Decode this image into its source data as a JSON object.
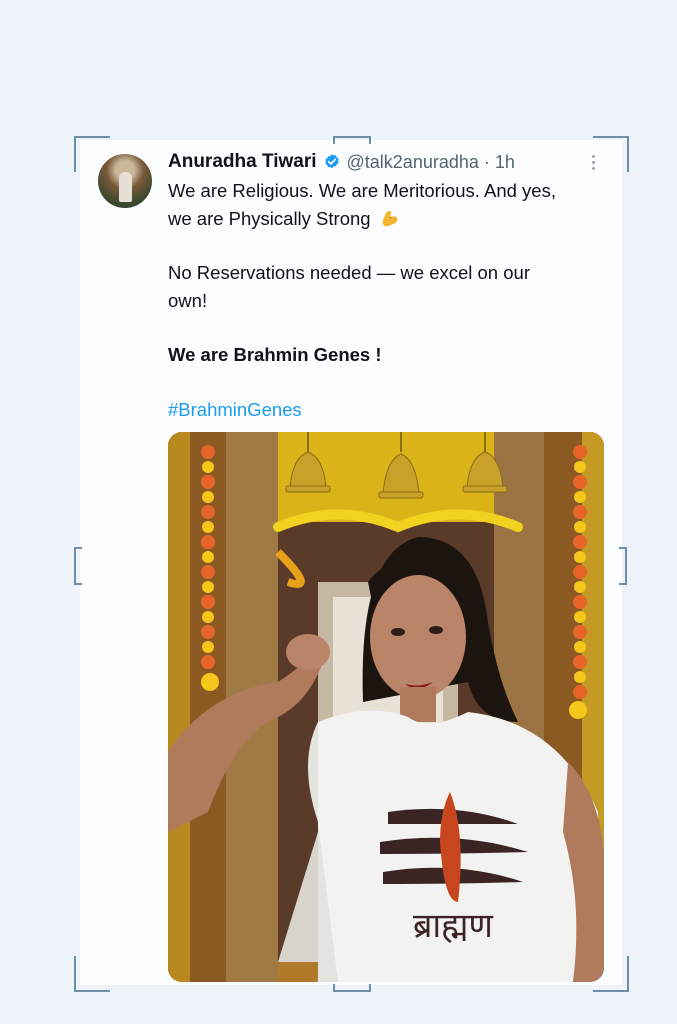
{
  "tweet": {
    "author_name": "Anuradha Tiwari",
    "handle_time": "@talk2anuradha · 1h",
    "lines": [
      "We are Religious. We are Meritorious. And yes,",
      "we are Physically Strong",
      "No Reservations needed — we excel on our",
      "own!",
      "We are Brahmin Genes !"
    ],
    "hashtag": "#BrahminGenes",
    "shirt_text": "ब्राह्मण"
  },
  "icons": {
    "verified": "verified-badge-icon",
    "more": "more-options-icon",
    "emoji": "flexed-biceps-emoji"
  },
  "colors": {
    "accent": "#1d9bf0",
    "text": "#0f1419",
    "muted": "#536471"
  }
}
